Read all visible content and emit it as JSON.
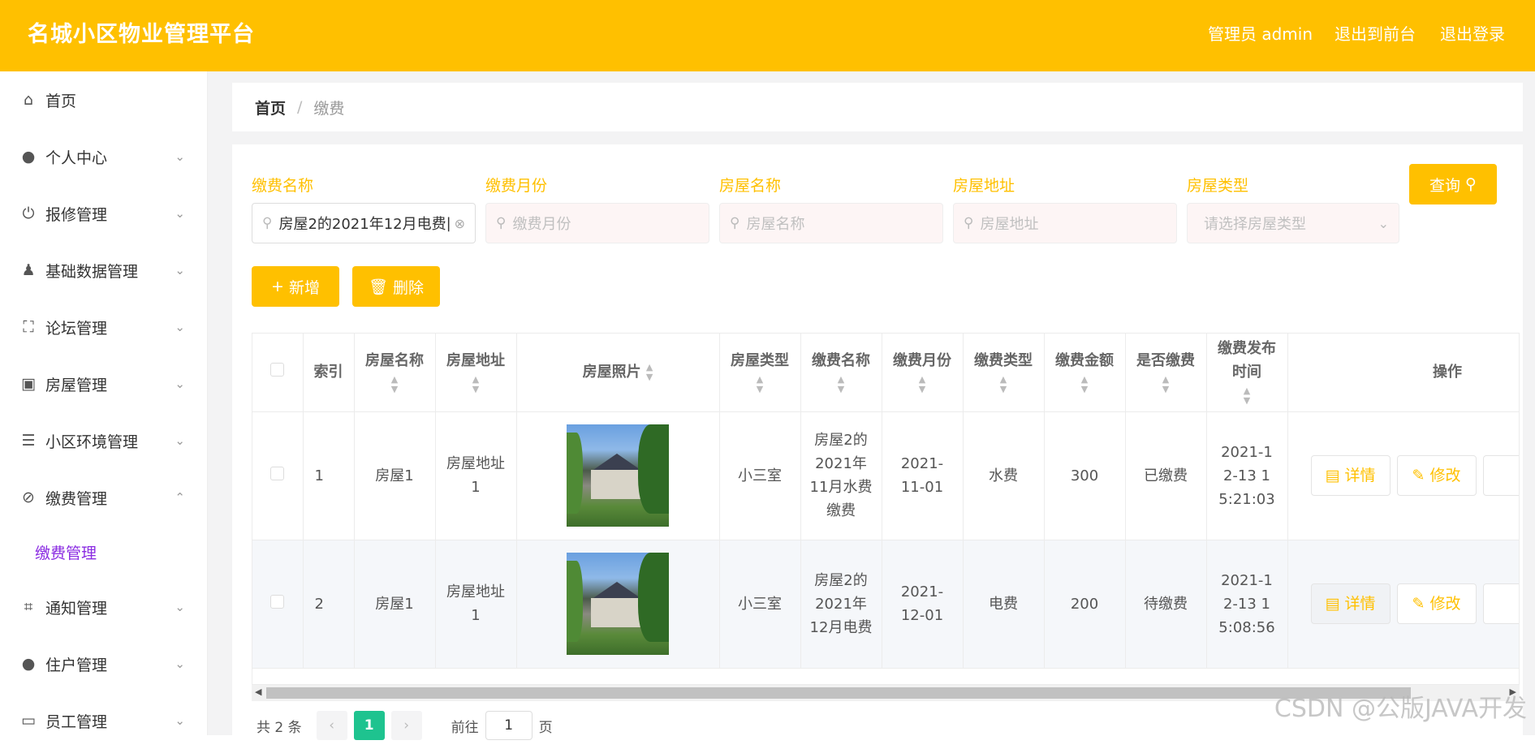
{
  "header": {
    "title": "名城小区物业管理平台",
    "admin": "管理员 admin",
    "to_front": "退出到前台",
    "logout": "退出登录"
  },
  "sidebar": {
    "items": [
      {
        "label": "首页",
        "icon": "home-icon",
        "expandable": false
      },
      {
        "label": "个人中心",
        "icon": "user-icon",
        "expandable": true
      },
      {
        "label": "报修管理",
        "icon": "power-icon",
        "expandable": true
      },
      {
        "label": "基础数据管理",
        "icon": "stamp-icon",
        "expandable": true
      },
      {
        "label": "论坛管理",
        "icon": "frame-icon",
        "expandable": true
      },
      {
        "label": "房屋管理",
        "icon": "wallet-icon",
        "expandable": true
      },
      {
        "label": "小区环境管理",
        "icon": "list-icon",
        "expandable": true
      },
      {
        "label": "缴费管理",
        "icon": "bell-off-icon",
        "expandable": true,
        "expanded": true
      },
      {
        "label": "通知管理",
        "icon": "crop-icon",
        "expandable": true
      },
      {
        "label": "住户管理",
        "icon": "bulb-icon",
        "expandable": true
      },
      {
        "label": "员工管理",
        "icon": "message-icon",
        "expandable": true
      }
    ],
    "sub_item": "缴费管理"
  },
  "breadcrumb": {
    "home": "首页",
    "sep": "/",
    "current": "缴费"
  },
  "filters": {
    "fee_name": {
      "label": "缴费名称",
      "value": "房屋2的2021年12月电费"
    },
    "fee_month": {
      "label": "缴费月份",
      "placeholder": "缴费月份"
    },
    "house_name": {
      "label": "房屋名称",
      "placeholder": "房屋名称"
    },
    "house_addr": {
      "label": "房屋地址",
      "placeholder": "房屋地址"
    },
    "house_type": {
      "label": "房屋类型",
      "placeholder": "请选择房屋类型"
    },
    "query_label": "查询"
  },
  "actions": {
    "add_label": "新增",
    "delete_label": "删除"
  },
  "table": {
    "headers": {
      "index": "索引",
      "house_name": "房屋名称",
      "house_addr": "房屋地址",
      "photo": "房屋照片",
      "house_type": "房屋类型",
      "fee_name": "缴费名称",
      "fee_month": "缴费月份",
      "fee_type": "缴费类型",
      "amount": "缴费金额",
      "paid": "是否缴费",
      "publish_time": "缴费发布时间",
      "ops": "操作"
    },
    "rows": [
      {
        "index": "1",
        "house_name": "房屋1",
        "house_addr": "房屋地址1",
        "house_type": "小三室",
        "fee_name": "房屋2的2021年11月水费缴费",
        "fee_month": "2021-11-01",
        "fee_type": "水费",
        "amount": "300",
        "paid": "已缴费",
        "publish_time": "2021-12-13 15:21:03"
      },
      {
        "index": "2",
        "house_name": "房屋1",
        "house_addr": "房屋地址1",
        "house_type": "小三室",
        "fee_name": "房屋2的2021年12月电费",
        "fee_month": "2021-12-01",
        "fee_type": "电费",
        "amount": "200",
        "paid": "待缴费",
        "publish_time": "2021-12-13 15:08:56"
      }
    ],
    "detail_label": "详情",
    "edit_label": "修改"
  },
  "pagination": {
    "total": "共 2 条",
    "current": "1",
    "goto": "前往",
    "page_value": "1",
    "page_unit": "页"
  },
  "watermark": "CSDN @公版JAVA开发",
  "colors": {
    "accent": "#ffc000",
    "active_page": "#1ec38f",
    "submenu": "#8a2be2"
  }
}
